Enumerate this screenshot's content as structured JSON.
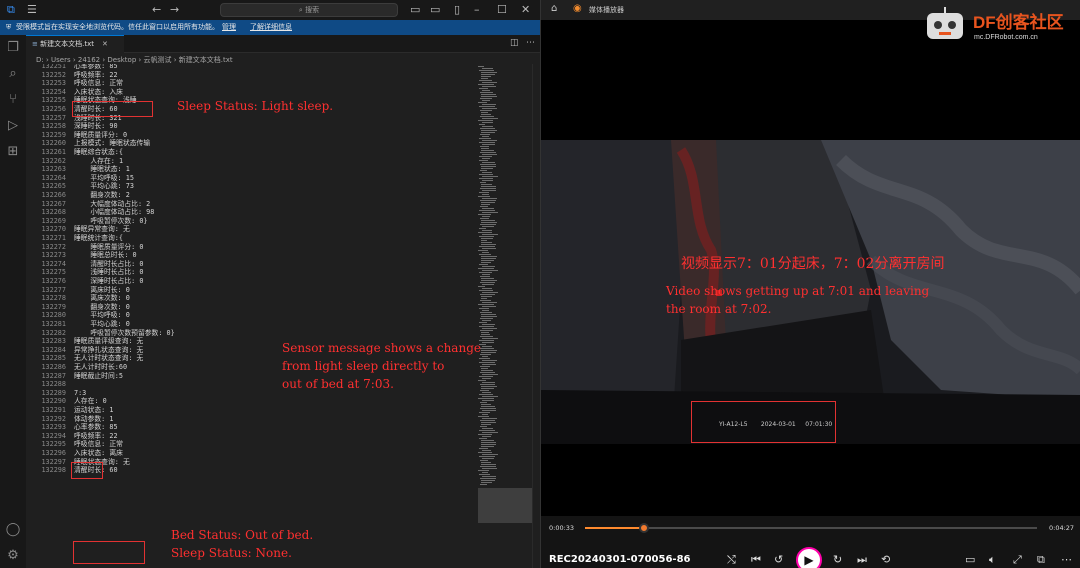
{
  "vscode": {
    "search_label": "搜索",
    "banner": {
      "text": "受限模式旨在实现安全地浏览代码。信任此窗口以启用所有功能。",
      "manage_link": "管理",
      "more_link": "了解详细信息"
    },
    "tab": {
      "label": "新建文本文档.txt"
    },
    "breadcrumb": [
      "D:",
      "Users",
      "24162",
      "Desktop",
      "云帆测试",
      "新建文本文档.txt"
    ],
    "editor_lines": [
      {
        "n": "132251",
        "t": "心率参数: 85"
      },
      {
        "n": "132252",
        "t": "呼吸频率: 22"
      },
      {
        "n": "132253",
        "t": "呼吸信息: 正常"
      },
      {
        "n": "132254",
        "t": "入床状态: 入床"
      },
      {
        "n": "132255",
        "t": "睡眠状态查询: 浅睡"
      },
      {
        "n": "132256",
        "t": "清醒时长: 60"
      },
      {
        "n": "132257",
        "t": "浅睡时长: 321"
      },
      {
        "n": "132258",
        "t": "深睡时长: 90"
      },
      {
        "n": "132259",
        "t": "睡眠质量评分: 0"
      },
      {
        "n": "132260",
        "t": "上报模式: 睡眠状态传输"
      },
      {
        "n": "132261",
        "t": "睡眠综合状态:{"
      },
      {
        "n": "132262",
        "t": "    人存在: 1"
      },
      {
        "n": "132263",
        "t": "    睡眠状态: 1"
      },
      {
        "n": "132264",
        "t": "    平均呼吸: 15"
      },
      {
        "n": "132265",
        "t": "    平均心跳: 73"
      },
      {
        "n": "132266",
        "t": "    翻身次数: 2"
      },
      {
        "n": "132267",
        "t": "    大幅度体动占比: 2"
      },
      {
        "n": "132268",
        "t": "    小幅度体动占比: 98"
      },
      {
        "n": "132269",
        "t": "    呼吸暂停次数: 0}"
      },
      {
        "n": "132270",
        "t": "睡眠异常查询: 无"
      },
      {
        "n": "132271",
        "t": "睡眠统计查询:{"
      },
      {
        "n": "132272",
        "t": "    睡眠质量评分: 0"
      },
      {
        "n": "132273",
        "t": "    睡眠总时长: 0"
      },
      {
        "n": "132274",
        "t": "    清醒时长占比: 0"
      },
      {
        "n": "132275",
        "t": "    浅睡时长占比: 0"
      },
      {
        "n": "132276",
        "t": "    深睡时长占比: 0"
      },
      {
        "n": "132277",
        "t": "    离床时长: 0"
      },
      {
        "n": "132278",
        "t": "    离床次数: 0"
      },
      {
        "n": "132279",
        "t": "    翻身次数: 0"
      },
      {
        "n": "132280",
        "t": "    平均呼吸: 0"
      },
      {
        "n": "132281",
        "t": "    平均心跳: 0"
      },
      {
        "n": "132282",
        "t": "    呼吸暂停次数预留参数: 0}"
      },
      {
        "n": "132283",
        "t": "睡眠质量评级查询: 无"
      },
      {
        "n": "132284",
        "t": "异常挣扎状态查询: 无"
      },
      {
        "n": "132285",
        "t": "无人计时状态查询: 无"
      },
      {
        "n": "132286",
        "t": "无人计时时长:60"
      },
      {
        "n": "132287",
        "t": "睡眠截止时间:5"
      },
      {
        "n": "132288",
        "t": ""
      },
      {
        "n": "132289",
        "t": "7:3"
      },
      {
        "n": "132290",
        "t": "人存在: 0"
      },
      {
        "n": "132291",
        "t": "运动状态: 1"
      },
      {
        "n": "132292",
        "t": "体动参数: 1"
      },
      {
        "n": "132293",
        "t": "心率参数: 85"
      },
      {
        "n": "132294",
        "t": "呼吸频率: 22"
      },
      {
        "n": "132295",
        "t": "呼吸信息: 正常"
      },
      {
        "n": "132296",
        "t": "入床状态: 离床"
      },
      {
        "n": "132297",
        "t": "睡眠状态查询: 无"
      },
      {
        "n": "132298",
        "t": "清醒时长: 60"
      }
    ]
  },
  "annotations": {
    "sleep_status": "Sleep Status: Light sleep.",
    "sensor_msg": [
      "Sensor message shows a change",
      "from light sleep directly to",
      "out of bed at 7:03."
    ],
    "bed_status": "Bed Status: Out of bed.",
    "sleep_none": "Sleep Status: None.",
    "video_cn": "视频显示7：01分起床，7：02分离开房间",
    "video_en": [
      "Video shows getting up at 7:01 and leaving",
      "the room at 7:02."
    ]
  },
  "player": {
    "title": "媒体播放器",
    "logo": "DF创客社区",
    "logo_url": "mc.DFRobot.com.cn",
    "osd": "YI-A12-L5       2024-03-01     07:01:30",
    "time_current": "0:00:33",
    "time_total": "0:04:27",
    "progress": 0.13,
    "file_name": "REC20240301-070056-86"
  },
  "colors": {
    "annotation": "#ff3030",
    "seek": "#ff8a2e",
    "banner": "#0f4a85"
  }
}
